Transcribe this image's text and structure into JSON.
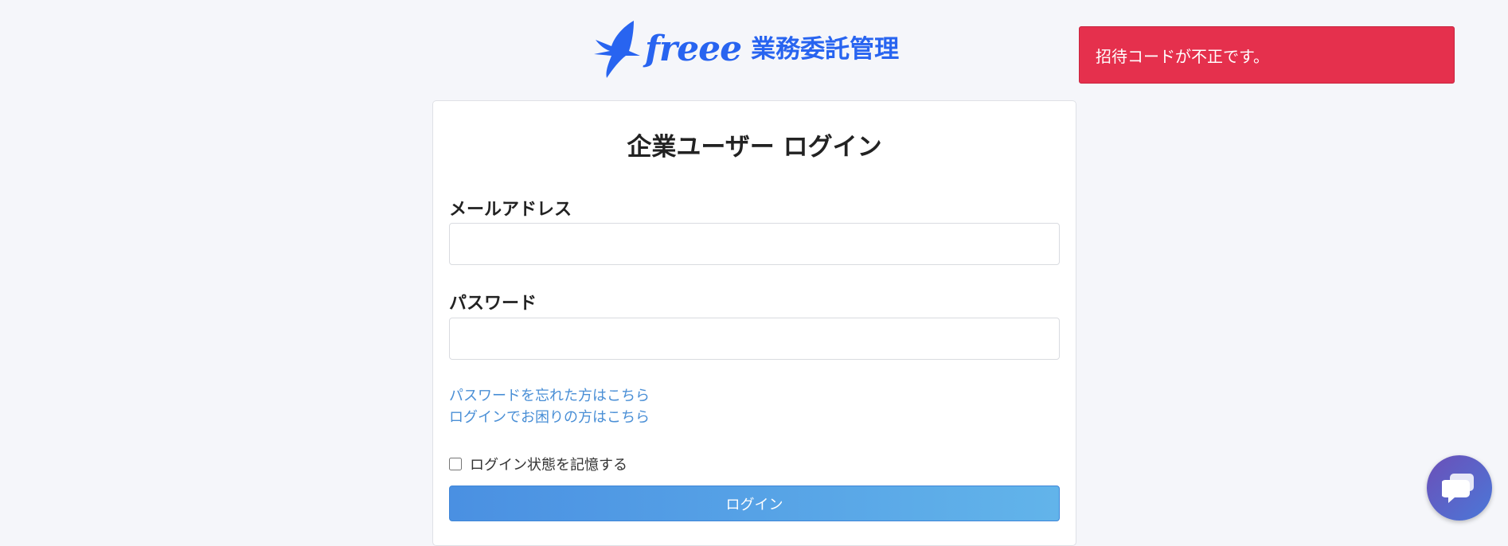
{
  "logo": {
    "brand": "freee",
    "product": "業務委託管理",
    "icon": "swallow-logo-icon"
  },
  "toast": {
    "message": "招待コードが不正です。",
    "color": "#e5304d"
  },
  "login": {
    "title": "企業ユーザー ログイン",
    "email_label": "メールアドレス",
    "email_value": "",
    "email_placeholder": "",
    "password_label": "パスワード",
    "password_value": "",
    "password_placeholder": "",
    "forgot_password_link": "パスワードを忘れた方はこちら",
    "trouble_link": "ログインでお困りの方はこちら",
    "remember_label": "ログイン状態を記憶する",
    "submit_label": "ログイン"
  },
  "chat": {
    "icon": "chat-bubble-icon"
  },
  "colors": {
    "brand": "#2864f0",
    "link": "#4a8fd6",
    "error": "#e5304d",
    "button_start": "#4a90e2",
    "button_end": "#62b4ea"
  }
}
